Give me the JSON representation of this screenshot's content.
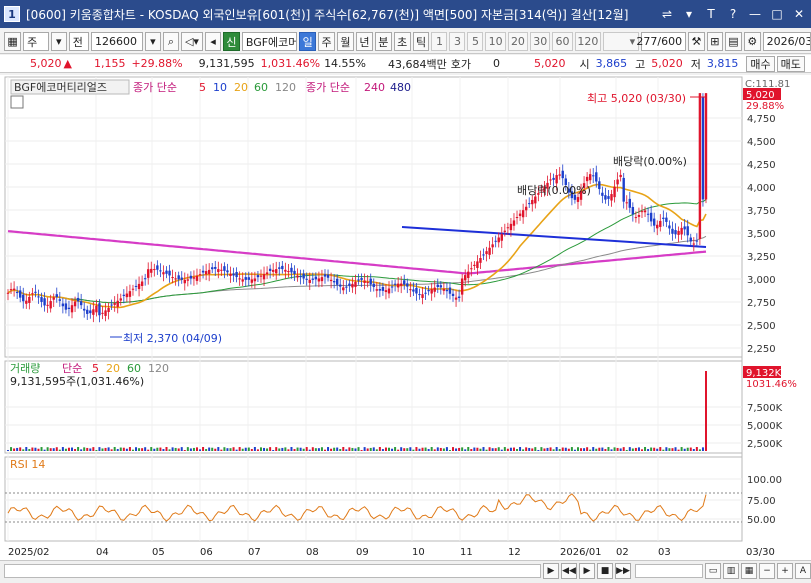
{
  "window": {
    "screen_no": "1",
    "title": "[0600] 키움종합차트 - KOSDAQ 외국인보유[601(천)] 주식수[62,767(천)] 액면[500] 자본금[314(억)] 결산[12월]"
  },
  "toolbar": {
    "type_main": "주",
    "type_sub": "전",
    "code": "126600",
    "new_badge": "신",
    "stock_name": "BGF에코머티",
    "periods": [
      "일",
      "주",
      "월",
      "년",
      "분",
      "초",
      "틱"
    ],
    "period_selected": "일",
    "intervals": [
      "1",
      "3",
      "5",
      "10",
      "20",
      "30",
      "60",
      "120"
    ],
    "count": "277",
    "count_max": "/600",
    "date": "2026/03/"
  },
  "info": {
    "price": "5,020",
    "change": "1,155",
    "change_pct": "+29.88%",
    "volume": "9,131,595",
    "volume_pct": "1,031.46%",
    "turnover": "14.55%",
    "amount": "43,684백만",
    "quote_label": "호가",
    "quote_val": "0",
    "quote_price": "5,020",
    "open_label": "시",
    "open": "3,865",
    "high_label": "고",
    "high": "5,020",
    "low_label": "저",
    "low": "3,815",
    "buy": "매수",
    "sell": "매도"
  },
  "price_panel": {
    "name": "BGF에코머티리얼즈",
    "ma_label": "종가 단순",
    "ma_periods": [
      "5",
      "10",
      "20",
      "60",
      "120"
    ],
    "ma2_label": "종가 단순",
    "ma2_periods": [
      "240",
      "480"
    ],
    "right_top": "C:111.81",
    "last_price_tag": "5,020",
    "last_pct_tag": "29.88%",
    "high_annot": "최고 5,020 (03/30)",
    "low_annot": "최저 2,370 (04/09)",
    "div_annot_1": "배당락(0.00%)",
    "div_annot_2": "배당락(0.00%)",
    "y_ticks": [
      "4,750",
      "4,500",
      "4,250",
      "4,000",
      "3,750",
      "3,500",
      "3,250",
      "3,000",
      "2,750",
      "2,500",
      "2,250"
    ]
  },
  "volume_panel": {
    "label": "거래량",
    "ma_label": "단순",
    "ma_periods": [
      "5",
      "20",
      "60",
      "120"
    ],
    "value_text": "9,131,595주(1,031.46%)",
    "tag_val": "9,132K",
    "tag_pct": "1031.46%",
    "y_ticks": [
      "7,500K",
      "5,000K",
      "2,500K"
    ]
  },
  "rsi_panel": {
    "label": "RSI 14",
    "y_ticks": [
      "100.00",
      "75.00",
      "50.00"
    ]
  },
  "x_axis": [
    "2025/02",
    "04",
    "05",
    "06",
    "07",
    "08",
    "09",
    "10",
    "11",
    "12",
    "2026/01",
    "02",
    "03"
  ],
  "x_right_label": "03/30",
  "colors": {
    "up": "#e0142c",
    "down": "#1d3fcc",
    "ma240": "#d63cc6",
    "trend": "#1d2fd8"
  }
}
